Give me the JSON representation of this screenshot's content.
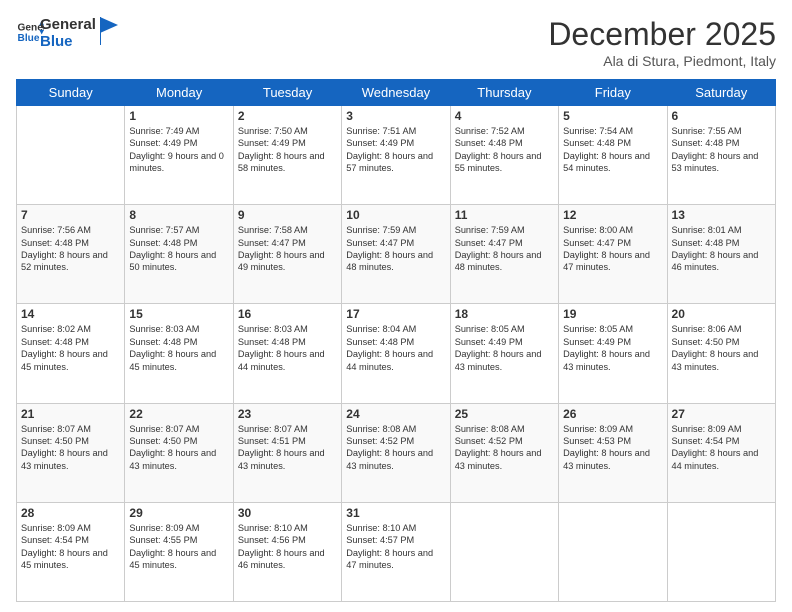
{
  "logo": {
    "line1": "General",
    "line2": "Blue"
  },
  "title": "December 2025",
  "subtitle": "Ala di Stura, Piedmont, Italy",
  "days_of_week": [
    "Sunday",
    "Monday",
    "Tuesday",
    "Wednesday",
    "Thursday",
    "Friday",
    "Saturday"
  ],
  "weeks": [
    [
      {
        "day": "",
        "sunrise": "",
        "sunset": "",
        "daylight": ""
      },
      {
        "day": "1",
        "sunrise": "Sunrise: 7:49 AM",
        "sunset": "Sunset: 4:49 PM",
        "daylight": "Daylight: 9 hours and 0 minutes."
      },
      {
        "day": "2",
        "sunrise": "Sunrise: 7:50 AM",
        "sunset": "Sunset: 4:49 PM",
        "daylight": "Daylight: 8 hours and 58 minutes."
      },
      {
        "day": "3",
        "sunrise": "Sunrise: 7:51 AM",
        "sunset": "Sunset: 4:49 PM",
        "daylight": "Daylight: 8 hours and 57 minutes."
      },
      {
        "day": "4",
        "sunrise": "Sunrise: 7:52 AM",
        "sunset": "Sunset: 4:48 PM",
        "daylight": "Daylight: 8 hours and 55 minutes."
      },
      {
        "day": "5",
        "sunrise": "Sunrise: 7:54 AM",
        "sunset": "Sunset: 4:48 PM",
        "daylight": "Daylight: 8 hours and 54 minutes."
      },
      {
        "day": "6",
        "sunrise": "Sunrise: 7:55 AM",
        "sunset": "Sunset: 4:48 PM",
        "daylight": "Daylight: 8 hours and 53 minutes."
      }
    ],
    [
      {
        "day": "7",
        "sunrise": "Sunrise: 7:56 AM",
        "sunset": "Sunset: 4:48 PM",
        "daylight": "Daylight: 8 hours and 52 minutes."
      },
      {
        "day": "8",
        "sunrise": "Sunrise: 7:57 AM",
        "sunset": "Sunset: 4:48 PM",
        "daylight": "Daylight: 8 hours and 50 minutes."
      },
      {
        "day": "9",
        "sunrise": "Sunrise: 7:58 AM",
        "sunset": "Sunset: 4:47 PM",
        "daylight": "Daylight: 8 hours and 49 minutes."
      },
      {
        "day": "10",
        "sunrise": "Sunrise: 7:59 AM",
        "sunset": "Sunset: 4:47 PM",
        "daylight": "Daylight: 8 hours and 48 minutes."
      },
      {
        "day": "11",
        "sunrise": "Sunrise: 7:59 AM",
        "sunset": "Sunset: 4:47 PM",
        "daylight": "Daylight: 8 hours and 48 minutes."
      },
      {
        "day": "12",
        "sunrise": "Sunrise: 8:00 AM",
        "sunset": "Sunset: 4:47 PM",
        "daylight": "Daylight: 8 hours and 47 minutes."
      },
      {
        "day": "13",
        "sunrise": "Sunrise: 8:01 AM",
        "sunset": "Sunset: 4:48 PM",
        "daylight": "Daylight: 8 hours and 46 minutes."
      }
    ],
    [
      {
        "day": "14",
        "sunrise": "Sunrise: 8:02 AM",
        "sunset": "Sunset: 4:48 PM",
        "daylight": "Daylight: 8 hours and 45 minutes."
      },
      {
        "day": "15",
        "sunrise": "Sunrise: 8:03 AM",
        "sunset": "Sunset: 4:48 PM",
        "daylight": "Daylight: 8 hours and 45 minutes."
      },
      {
        "day": "16",
        "sunrise": "Sunrise: 8:03 AM",
        "sunset": "Sunset: 4:48 PM",
        "daylight": "Daylight: 8 hours and 44 minutes."
      },
      {
        "day": "17",
        "sunrise": "Sunrise: 8:04 AM",
        "sunset": "Sunset: 4:48 PM",
        "daylight": "Daylight: 8 hours and 44 minutes."
      },
      {
        "day": "18",
        "sunrise": "Sunrise: 8:05 AM",
        "sunset": "Sunset: 4:49 PM",
        "daylight": "Daylight: 8 hours and 43 minutes."
      },
      {
        "day": "19",
        "sunrise": "Sunrise: 8:05 AM",
        "sunset": "Sunset: 4:49 PM",
        "daylight": "Daylight: 8 hours and 43 minutes."
      },
      {
        "day": "20",
        "sunrise": "Sunrise: 8:06 AM",
        "sunset": "Sunset: 4:50 PM",
        "daylight": "Daylight: 8 hours and 43 minutes."
      }
    ],
    [
      {
        "day": "21",
        "sunrise": "Sunrise: 8:07 AM",
        "sunset": "Sunset: 4:50 PM",
        "daylight": "Daylight: 8 hours and 43 minutes."
      },
      {
        "day": "22",
        "sunrise": "Sunrise: 8:07 AM",
        "sunset": "Sunset: 4:50 PM",
        "daylight": "Daylight: 8 hours and 43 minutes."
      },
      {
        "day": "23",
        "sunrise": "Sunrise: 8:07 AM",
        "sunset": "Sunset: 4:51 PM",
        "daylight": "Daylight: 8 hours and 43 minutes."
      },
      {
        "day": "24",
        "sunrise": "Sunrise: 8:08 AM",
        "sunset": "Sunset: 4:52 PM",
        "daylight": "Daylight: 8 hours and 43 minutes."
      },
      {
        "day": "25",
        "sunrise": "Sunrise: 8:08 AM",
        "sunset": "Sunset: 4:52 PM",
        "daylight": "Daylight: 8 hours and 43 minutes."
      },
      {
        "day": "26",
        "sunrise": "Sunrise: 8:09 AM",
        "sunset": "Sunset: 4:53 PM",
        "daylight": "Daylight: 8 hours and 43 minutes."
      },
      {
        "day": "27",
        "sunrise": "Sunrise: 8:09 AM",
        "sunset": "Sunset: 4:54 PM",
        "daylight": "Daylight: 8 hours and 44 minutes."
      }
    ],
    [
      {
        "day": "28",
        "sunrise": "Sunrise: 8:09 AM",
        "sunset": "Sunset: 4:54 PM",
        "daylight": "Daylight: 8 hours and 45 minutes."
      },
      {
        "day": "29",
        "sunrise": "Sunrise: 8:09 AM",
        "sunset": "Sunset: 4:55 PM",
        "daylight": "Daylight: 8 hours and 45 minutes."
      },
      {
        "day": "30",
        "sunrise": "Sunrise: 8:10 AM",
        "sunset": "Sunset: 4:56 PM",
        "daylight": "Daylight: 8 hours and 46 minutes."
      },
      {
        "day": "31",
        "sunrise": "Sunrise: 8:10 AM",
        "sunset": "Sunset: 4:57 PM",
        "daylight": "Daylight: 8 hours and 47 minutes."
      },
      {
        "day": "",
        "sunrise": "",
        "sunset": "",
        "daylight": ""
      },
      {
        "day": "",
        "sunrise": "",
        "sunset": "",
        "daylight": ""
      },
      {
        "day": "",
        "sunrise": "",
        "sunset": "",
        "daylight": ""
      }
    ]
  ]
}
